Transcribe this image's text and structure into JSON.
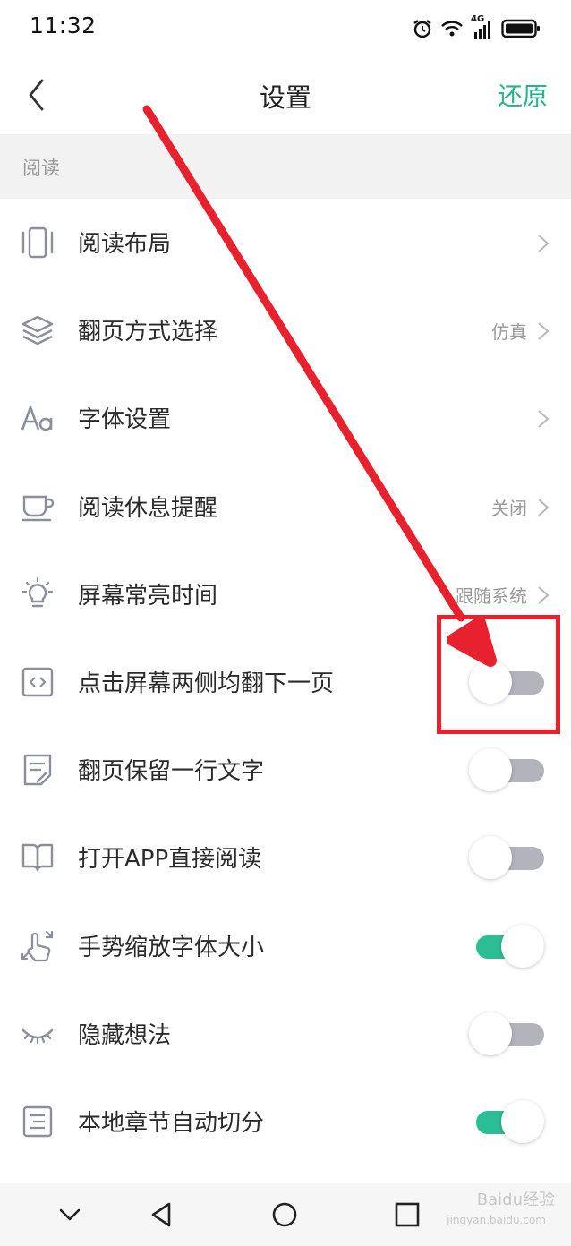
{
  "status_bar": {
    "time": "11:32",
    "network_label": "4G"
  },
  "header": {
    "title": "设置",
    "restore_label": "还原"
  },
  "section": {
    "title": "阅读"
  },
  "rows": [
    {
      "label": "阅读布局",
      "value": "",
      "icon": "layout-icon",
      "control": "chevron"
    },
    {
      "label": "翻页方式选择",
      "value": "仿真",
      "icon": "layers-icon",
      "control": "chevron"
    },
    {
      "label": "字体设置",
      "value": "",
      "icon": "font-icon",
      "control": "chevron"
    },
    {
      "label": "阅读休息提醒",
      "value": "关闭",
      "icon": "cup-icon",
      "control": "chevron"
    },
    {
      "label": "屏幕常亮时间",
      "value": "跟随系统",
      "icon": "bulb-icon",
      "control": "chevron"
    },
    {
      "label": "点击屏幕两侧均翻下一页",
      "icon": "code-icon",
      "control": "toggle",
      "on": false
    },
    {
      "label": "翻页保留一行文字",
      "icon": "note-icon",
      "control": "toggle",
      "on": false
    },
    {
      "label": "打开APP直接阅读",
      "icon": "book-icon",
      "control": "toggle",
      "on": false
    },
    {
      "label": "手势缩放字体大小",
      "icon": "gesture-icon",
      "control": "toggle",
      "on": true
    },
    {
      "label": "隐藏想法",
      "icon": "eye-closed-icon",
      "control": "toggle",
      "on": false
    },
    {
      "label": "本地章节自动切分",
      "icon": "list-icon",
      "control": "toggle",
      "on": true
    }
  ],
  "colors": {
    "accent": "#2ab38f",
    "toggle_on": "#2bbd94",
    "toggle_off": "#b3b4bb",
    "annotation": "#e8212e"
  },
  "watermark": {
    "brand": "Baidu经验",
    "sub": "jingyan.baidu.com"
  }
}
